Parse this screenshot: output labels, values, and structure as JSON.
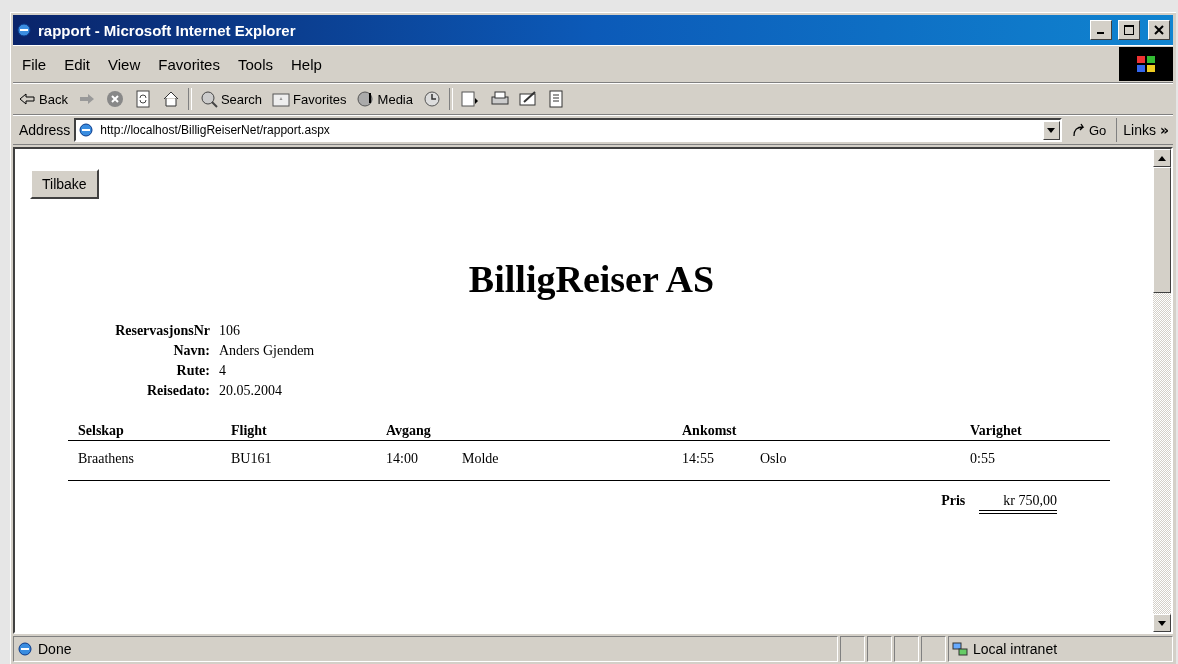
{
  "window": {
    "title": "rapport - Microsoft Internet Explorer"
  },
  "menu": [
    "File",
    "Edit",
    "View",
    "Favorites",
    "Tools",
    "Help"
  ],
  "toolbar": [
    {
      "kind": "back",
      "label": "Back"
    },
    {
      "kind": "forward"
    },
    {
      "kind": "stop"
    },
    {
      "kind": "refresh"
    },
    {
      "kind": "home"
    },
    {
      "kind": "sep"
    },
    {
      "kind": "search",
      "label": "Search"
    },
    {
      "kind": "favorites",
      "label": "Favorites"
    },
    {
      "kind": "media",
      "label": "Media"
    },
    {
      "kind": "history"
    },
    {
      "kind": "sep"
    },
    {
      "kind": "mail"
    },
    {
      "kind": "print"
    },
    {
      "kind": "edit"
    },
    {
      "kind": "discuss"
    }
  ],
  "address": {
    "label": "Address",
    "value": "http://localhost/BilligReiserNet/rapport.aspx",
    "go": "Go",
    "links": "Links",
    "more": "»"
  },
  "page": {
    "back_button": "Tilbake",
    "heading": "BilligReiser AS",
    "info": [
      {
        "label": "ReservasjonsNr",
        "value": "106"
      },
      {
        "label": "Navn:",
        "value": "Anders Gjendem"
      },
      {
        "label": "Rute:",
        "value": "4"
      },
      {
        "label": "Reisedato:",
        "value": "20.05.2004"
      }
    ],
    "table": {
      "columns": [
        "Selskap",
        "Flight",
        "Avgang",
        "",
        "Ankomst",
        "",
        "Varighet"
      ],
      "rows": [
        [
          "Braathens",
          "BU161",
          "14:00",
          "Molde",
          "14:55",
          "Oslo",
          "0:55"
        ]
      ]
    },
    "price": {
      "label": "Pris",
      "value": "kr 750,00"
    }
  },
  "status_bar": {
    "text": "Done",
    "zone": "Local intranet"
  }
}
